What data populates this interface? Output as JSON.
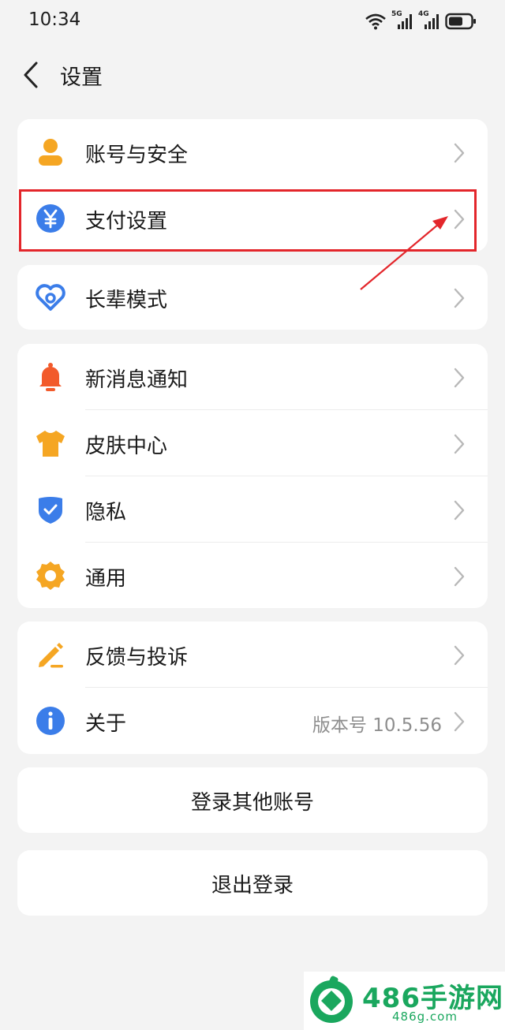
{
  "status_bar": {
    "time": "10:34",
    "net1": "5G",
    "net2": "4G"
  },
  "header": {
    "title": "设置"
  },
  "groups": [
    {
      "items": [
        {
          "label": "账号与安全",
          "icon": "person-icon",
          "color": "#f5a623"
        },
        {
          "label": "支付设置",
          "icon": "yuan-icon",
          "color": "#3b7de9"
        }
      ]
    },
    {
      "items": [
        {
          "label": "长辈模式",
          "icon": "heart-icon",
          "color": "#3b7de9"
        }
      ]
    },
    {
      "items": [
        {
          "label": "新消息通知",
          "icon": "bell-icon",
          "color": "#f25a2b"
        },
        {
          "label": "皮肤中心",
          "icon": "shirt-icon",
          "color": "#f5a623"
        },
        {
          "label": "隐私",
          "icon": "shield-icon",
          "color": "#3b7de9"
        },
        {
          "label": "通用",
          "icon": "gear-icon",
          "color": "#f5a623"
        }
      ]
    },
    {
      "items": [
        {
          "label": "反馈与投诉",
          "icon": "pencil-icon",
          "color": "#f5a623"
        },
        {
          "label": "关于",
          "icon": "info-icon",
          "color": "#3b7de9",
          "value": "版本号 10.5.56"
        }
      ]
    }
  ],
  "actions": {
    "switch_account": "登录其他账号",
    "logout": "退出登录"
  },
  "watermark": {
    "name": "486手游网",
    "url": "486g.com"
  },
  "colors": {
    "highlight": "#e3262b",
    "brand_green": "#1aa75e"
  }
}
